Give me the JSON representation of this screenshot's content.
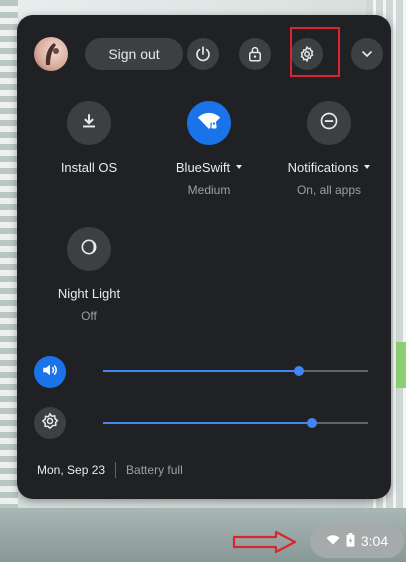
{
  "header": {
    "sign_out_label": "Sign out"
  },
  "tiles": [
    {
      "label": "Install OS",
      "sub": "",
      "icon": "download-icon",
      "active": false,
      "has_menu": false
    },
    {
      "label": "BlueSwift",
      "sub": "Medium",
      "icon": "wifi-icon",
      "active": true,
      "has_menu": true
    },
    {
      "label": "Notifications",
      "sub": "On, all apps",
      "icon": "notifications-icon",
      "active": false,
      "has_menu": true
    },
    {
      "label": "Night Light",
      "sub": "Off",
      "icon": "night-light-icon",
      "active": false,
      "has_menu": false
    }
  ],
  "sliders": {
    "volume": {
      "icon": "volume-icon",
      "level": 0.74
    },
    "brightness": {
      "icon": "brightness-icon",
      "level": 0.79
    }
  },
  "footer": {
    "date": "Mon, Sep 23",
    "battery": "Battery full"
  },
  "tray": {
    "time": "3:04"
  },
  "colors": {
    "panel": "#202124",
    "accent": "#1a73e8",
    "highlight": "#d9262c"
  }
}
